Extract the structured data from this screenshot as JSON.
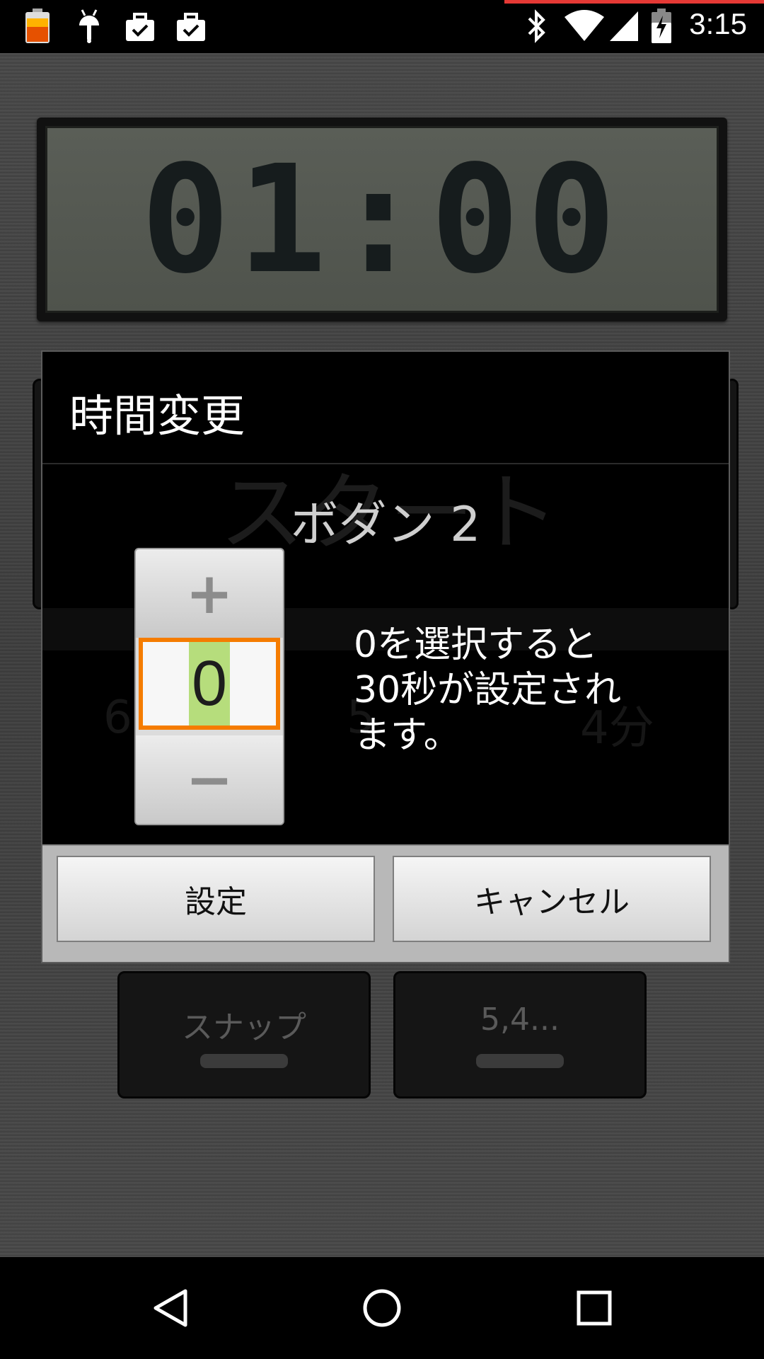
{
  "status_bar": {
    "time": "3:15",
    "icons": [
      "battery-charging-icon",
      "android-icon",
      "briefcase-check-icon",
      "briefcase-check-icon",
      "bluetooth-icon",
      "wifi-icon",
      "cell-signal-icon",
      "battery-icon"
    ]
  },
  "display": {
    "time": "01:00"
  },
  "background_buttons": {
    "start_label": "スタート",
    "six_label": "6",
    "five_label": "5",
    "four_label": "4分",
    "snap_label": "スナップ",
    "five_four_label": "5,4..."
  },
  "dialog": {
    "title": "時間変更",
    "subtitle": "ボダン 2",
    "picker": {
      "value": "0",
      "increment_symbol": "+",
      "decrement_symbol": "−"
    },
    "hint_lines": [
      "0を選択すると",
      "30秒が設定され",
      "ます。"
    ],
    "set_label": "設定",
    "cancel_label": "キャンセル"
  },
  "navigation": {
    "icons": [
      "back-icon",
      "home-icon",
      "recents-icon"
    ]
  },
  "colors": {
    "picker_focus": "#f57c00",
    "value_highlight": "#b6dd7c"
  }
}
